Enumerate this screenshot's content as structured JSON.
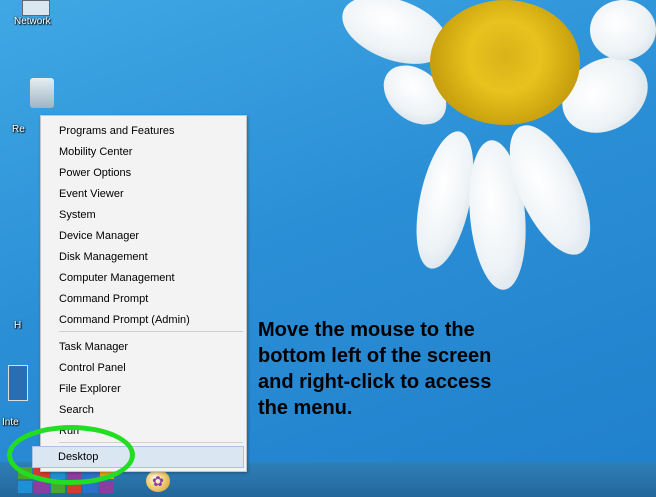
{
  "desktop": {
    "network_label": "Network",
    "recycle_label_partial": "Re",
    "icon3_label_partial": "H",
    "icon4_label_partial": "Inte"
  },
  "context_menu": {
    "items": [
      "Programs and Features",
      "Mobility Center",
      "Power Options",
      "Event Viewer",
      "System",
      "Device Manager",
      "Disk Management",
      "Computer Management",
      "Command Prompt",
      "Command Prompt (Admin)",
      "Task Manager",
      "Control Panel",
      "File Explorer",
      "Search",
      "Run",
      "Desktop"
    ]
  },
  "instruction": {
    "line1": "Move the mouse to the",
    "line2": "bottom left of the screen",
    "line3": "and right-click to access",
    "line4": "the menu."
  },
  "colors": {
    "highlight_circle": "#22dd22",
    "wallpaper": "#2b8fd6"
  }
}
